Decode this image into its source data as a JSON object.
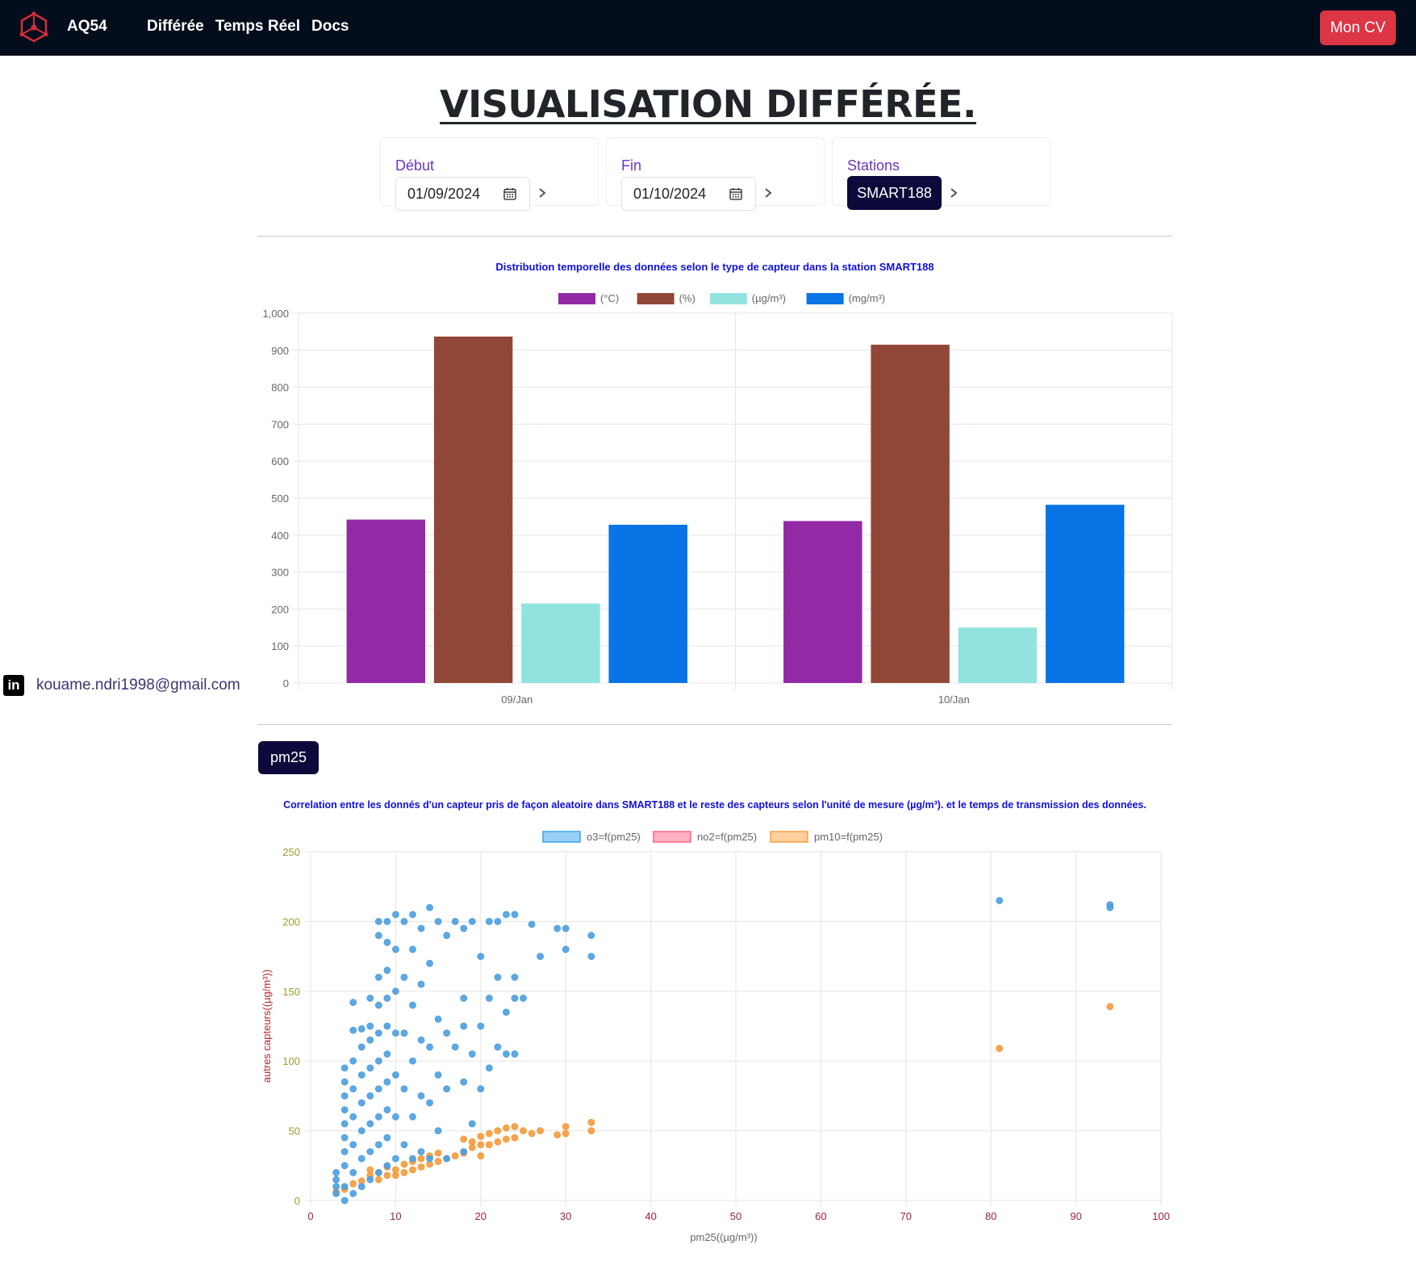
{
  "nav": {
    "brand": "AQ54",
    "links": [
      "Différée",
      "Temps Réel",
      "Docs"
    ],
    "cv_button": "Mon CV"
  },
  "page": {
    "title": "VISUALISATION DIFFÉRÉE."
  },
  "filters": {
    "start": {
      "label": "Début",
      "value": "01/09/2024"
    },
    "end": {
      "label": "Fin",
      "value": "01/10/2024"
    },
    "station": {
      "label": "Stations",
      "value": "SMART188"
    }
  },
  "contact": {
    "email": "kouame.ndri1998@gmail.com",
    "linkedin_glyph": "in"
  },
  "sensor_button": "pm25",
  "colors": {
    "navbar": "#030d1b",
    "accent_red": "#dc3545",
    "dark_button": "#0d0a3b",
    "label_purple": "#6a37c3",
    "chart_title_blue": "#1010d8"
  },
  "chart_data": [
    {
      "type": "bar",
      "title": "Distribution temporelle des données selon le type de capteur  dans la station SMART188",
      "categories": [
        "09/Jan",
        "10/Jan"
      ],
      "series": [
        {
          "name": "(°C)",
          "color": "#922aa6",
          "values": [
            442,
            438
          ]
        },
        {
          "name": "(%)",
          "color": "#914737",
          "values": [
            937,
            915
          ]
        },
        {
          "name": "(µg/m³)",
          "color": "#91e3e0",
          "values": [
            215,
            150
          ]
        },
        {
          "name": "(mg/m³)",
          "color": "#0874e5",
          "values": [
            428,
            482
          ]
        }
      ],
      "ylim": [
        0,
        1000
      ],
      "yticks": [
        "0",
        "100",
        "200",
        "300",
        "400",
        "500",
        "600",
        "700",
        "800",
        "900",
        "1,000"
      ],
      "legend": "top",
      "grid": true
    },
    {
      "type": "scatter",
      "title": "Correlation entre les donnés d'un capteur pris de façon aleatoire dans SMART188 et le reste des capteurs selon l'unité de mesure (µg/m³). et le temps de transmission des données.",
      "xlabel": "pm25((µg/m³))",
      "ylabel": "autres capteurs((µg/m³))",
      "xlim": [
        0,
        100
      ],
      "ylim": [
        0,
        250
      ],
      "xticks": [
        "0",
        "10",
        "20",
        "30",
        "40",
        "50",
        "60",
        "70",
        "80",
        "90",
        "100"
      ],
      "yticks": [
        "0",
        "50",
        "100",
        "150",
        "200",
        "250"
      ],
      "legend": "top",
      "grid": true,
      "series": [
        {
          "name": "o3=f(pm25)",
          "color": "#4b9ee0",
          "legend_fill": "#9ad0f5",
          "legend_border": "#36a2eb",
          "points": [
            [
              3,
              5
            ],
            [
              3,
              10
            ],
            [
              3,
              15
            ],
            [
              3,
              20
            ],
            [
              4,
              0
            ],
            [
              4,
              10
            ],
            [
              4,
              25
            ],
            [
              4,
              35
            ],
            [
              4,
              45
            ],
            [
              4,
              55
            ],
            [
              4,
              65
            ],
            [
              4,
              75
            ],
            [
              4,
              85
            ],
            [
              4,
              95
            ],
            [
              5,
              5
            ],
            [
              5,
              20
            ],
            [
              5,
              40
            ],
            [
              5,
              60
            ],
            [
              5,
              80
            ],
            [
              5,
              100
            ],
            [
              5,
              122
            ],
            [
              5,
              142
            ],
            [
              6,
              10
            ],
            [
              6,
              30
            ],
            [
              6,
              50
            ],
            [
              6,
              70
            ],
            [
              6,
              90
            ],
            [
              6,
              110
            ],
            [
              6,
              123
            ],
            [
              7,
              15
            ],
            [
              7,
              35
            ],
            [
              7,
              55
            ],
            [
              7,
              75
            ],
            [
              7,
              95
            ],
            [
              7,
              115
            ],
            [
              7,
              125
            ],
            [
              7,
              145
            ],
            [
              8,
              20
            ],
            [
              8,
              40
            ],
            [
              8,
              60
            ],
            [
              8,
              80
            ],
            [
              8,
              100
            ],
            [
              8,
              120
            ],
            [
              8,
              140
            ],
            [
              8,
              160
            ],
            [
              8,
              190
            ],
            [
              8,
              200
            ],
            [
              9,
              25
            ],
            [
              9,
              45
            ],
            [
              9,
              65
            ],
            [
              9,
              85
            ],
            [
              9,
              105
            ],
            [
              9,
              125
            ],
            [
              9,
              145
            ],
            [
              9,
              165
            ],
            [
              9,
              185
            ],
            [
              9,
              200
            ],
            [
              10,
              30
            ],
            [
              10,
              60
            ],
            [
              10,
              90
            ],
            [
              10,
              120
            ],
            [
              10,
              150
            ],
            [
              10,
              180
            ],
            [
              10,
              205
            ],
            [
              11,
              40
            ],
            [
              11,
              80
            ],
            [
              11,
              120
            ],
            [
              11,
              160
            ],
            [
              11,
              200
            ],
            [
              12,
              30
            ],
            [
              12,
              60
            ],
            [
              12,
              100
            ],
            [
              12,
              140
            ],
            [
              12,
              180
            ],
            [
              12,
              205
            ],
            [
              13,
              35
            ],
            [
              13,
              75
            ],
            [
              13,
              115
            ],
            [
              13,
              155
            ],
            [
              13,
              195
            ],
            [
              14,
              30
            ],
            [
              14,
              70
            ],
            [
              14,
              110
            ],
            [
              14,
              170
            ],
            [
              14,
              210
            ],
            [
              15,
              50
            ],
            [
              15,
              90
            ],
            [
              15,
              130
            ],
            [
              15,
              200
            ],
            [
              16,
              30
            ],
            [
              16,
              80
            ],
            [
              16,
              120
            ],
            [
              16,
              190
            ],
            [
              17,
              110
            ],
            [
              17,
              200
            ],
            [
              18,
              35
            ],
            [
              18,
              85
            ],
            [
              18,
              125
            ],
            [
              18,
              145
            ],
            [
              18,
              195
            ],
            [
              19,
              55
            ],
            [
              19,
              105
            ],
            [
              19,
              200
            ],
            [
              20,
              80
            ],
            [
              20,
              125
            ],
            [
              20,
              175
            ],
            [
              21,
              95
            ],
            [
              21,
              145
            ],
            [
              21,
              200
            ],
            [
              22,
              110
            ],
            [
              22,
              160
            ],
            [
              22,
              200
            ],
            [
              23,
              105
            ],
            [
              23,
              135
            ],
            [
              23,
              205
            ],
            [
              24,
              105
            ],
            [
              24,
              145
            ],
            [
              24,
              160
            ],
            [
              24,
              205
            ],
            [
              25,
              145
            ],
            [
              26,
              198
            ],
            [
              27,
              175
            ],
            [
              29,
              195
            ],
            [
              30,
              180
            ],
            [
              30,
              195
            ],
            [
              33,
              175
            ],
            [
              33,
              190
            ],
            [
              81,
              215
            ],
            [
              94,
              210
            ],
            [
              94,
              212
            ]
          ]
        },
        {
          "name": "no2=f(pm25)",
          "color": "#ff6384",
          "legend_fill": "#ffb1c1",
          "legend_border": "#ff6384",
          "points": []
        },
        {
          "name": "pm10=f(pm25)",
          "color": "#f59a3b",
          "legend_fill": "#ffcf9f",
          "legend_border": "#ff9f40",
          "points": [
            [
              3,
              6
            ],
            [
              4,
              8
            ],
            [
              5,
              12
            ],
            [
              6,
              14
            ],
            [
              7,
              18
            ],
            [
              7,
              22
            ],
            [
              8,
              15
            ],
            [
              8,
              20
            ],
            [
              9,
              18
            ],
            [
              9,
              24
            ],
            [
              10,
              18
            ],
            [
              10,
              22
            ],
            [
              11,
              20
            ],
            [
              11,
              26
            ],
            [
              12,
              22
            ],
            [
              12,
              28
            ],
            [
              13,
              24
            ],
            [
              13,
              30
            ],
            [
              14,
              26
            ],
            [
              14,
              32
            ],
            [
              15,
              28
            ],
            [
              15,
              34
            ],
            [
              16,
              30
            ],
            [
              17,
              32
            ],
            [
              18,
              34
            ],
            [
              18,
              44
            ],
            [
              19,
              38
            ],
            [
              19,
              42
            ],
            [
              20,
              32
            ],
            [
              20,
              40
            ],
            [
              20,
              46
            ],
            [
              21,
              40
            ],
            [
              21,
              48
            ],
            [
              22,
              42
            ],
            [
              22,
              50
            ],
            [
              23,
              44
            ],
            [
              23,
              52
            ],
            [
              24,
              45
            ],
            [
              24,
              53
            ],
            [
              25,
              50
            ],
            [
              26,
              48
            ],
            [
              27,
              50
            ],
            [
              29,
              47
            ],
            [
              30,
              48
            ],
            [
              30,
              53
            ],
            [
              33,
              50
            ],
            [
              33,
              56
            ],
            [
              81,
              109
            ],
            [
              94,
              139
            ]
          ]
        }
      ]
    }
  ]
}
